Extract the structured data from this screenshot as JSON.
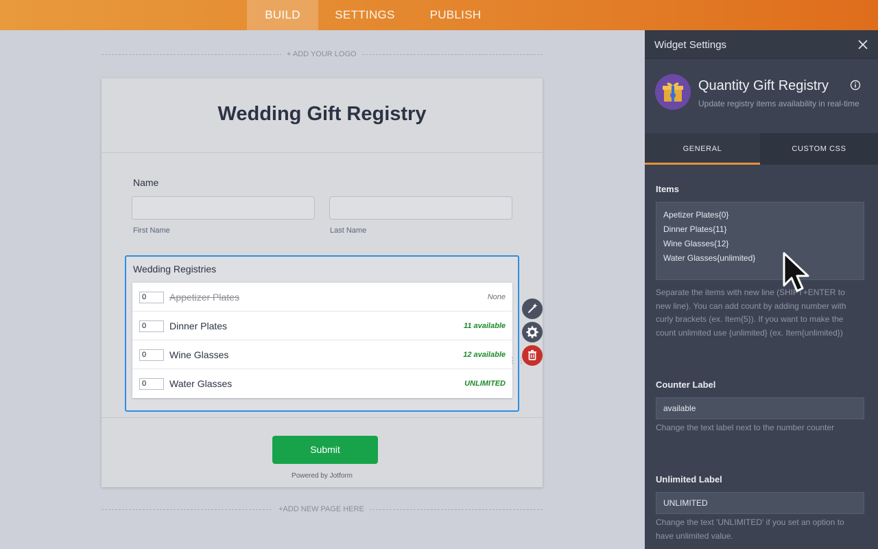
{
  "topbar": {
    "tabs": [
      {
        "label": "BUILD",
        "active": true
      },
      {
        "label": "SETTINGS",
        "active": false
      },
      {
        "label": "PUBLISH",
        "active": false
      }
    ]
  },
  "canvas": {
    "add_logo": "+ ADD YOUR LOGO",
    "add_page": "+ADD NEW PAGE HERE"
  },
  "form": {
    "title": "Wedding Gift Registry",
    "name_field": {
      "label": "Name",
      "first_sub": "First Name",
      "last_sub": "Last Name",
      "first_value": "",
      "last_value": ""
    },
    "registry": {
      "label": "Wedding Registries",
      "items": [
        {
          "qty": "0",
          "name": "Appetizer Plates",
          "status": "None",
          "sold_out": true
        },
        {
          "qty": "0",
          "name": "Dinner Plates",
          "status": "11 available",
          "sold_out": false
        },
        {
          "qty": "0",
          "name": "Wine Glasses",
          "status": "12 available",
          "sold_out": false
        },
        {
          "qty": "0",
          "name": "Water Glasses",
          "status": "UNLIMITED",
          "sold_out": false
        }
      ]
    },
    "submit_label": "Submit",
    "powered_by": "Powered by Jotform"
  },
  "side_tools": [
    {
      "icon": "magic-wand-icon",
      "color": "#4a5262"
    },
    {
      "icon": "gear-icon",
      "color": "#4a5262"
    },
    {
      "icon": "trash-icon",
      "color": "#c8302c"
    }
  ],
  "panel": {
    "header_title": "Widget Settings",
    "widget": {
      "name": "Quantity Gift Registry",
      "description": "Update registry items availability in real-time",
      "icon": "gift-icon"
    },
    "tabs": [
      {
        "label": "GENERAL",
        "active": true
      },
      {
        "label": "CUSTOM CSS",
        "active": false
      }
    ],
    "items_label": "Items",
    "items_value": "Apetizer Plates{0}\nDinner Plates{11}\nWine Glasses{12}\nWater Glasses{unlimited}",
    "items_help": "Separate the items with new line (SHIFT+ENTER to new line). You can add count by adding number with curly brackets (ex. Item{5}). If you want to make the count unlimited use {unlimited} (ex. Item{unlimited})",
    "counter_label": "Counter Label",
    "counter_value": "available",
    "counter_help": "Change the text label next to the number counter",
    "unlimited_label": "Unlimited Label",
    "unlimited_value": "UNLIMITED",
    "unlimited_help": "Change the text 'UNLIMITED' if you set an option to have unlimited value."
  },
  "colors": {
    "accent": "#e8923a",
    "focus": "#2e8fe0",
    "submit": "#18a34b",
    "available": "#1d8a2a"
  }
}
